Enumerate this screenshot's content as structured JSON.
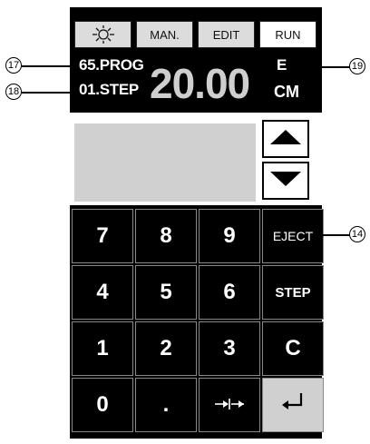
{
  "mode_bar": {
    "light_icon": "light-bulb-icon",
    "manual_label": "MAN.",
    "edit_label": "EDIT",
    "run_label": "RUN"
  },
  "display": {
    "program": "65.PROG",
    "step": "01.STEP",
    "value": "20.00",
    "unit_mode": "E",
    "unit": "CM"
  },
  "arrows": {
    "up_icon": "triangle-up-icon",
    "down_icon": "triangle-down-icon"
  },
  "keypad": {
    "keys": [
      "7",
      "8",
      "9",
      "EJECT",
      "4",
      "5",
      "6",
      "STEP",
      "1",
      "2",
      "3",
      "C",
      "0",
      "."
    ],
    "space_icon": "arrows-inward-icon",
    "enter_icon": "enter-return-icon"
  },
  "callouts": {
    "prog": "17",
    "step": "18",
    "unit": "19",
    "eject": "14"
  },
  "colors": {
    "panel": "#000000",
    "key_gray": "#d0d0d0",
    "value_text": "#cfcfcf"
  }
}
